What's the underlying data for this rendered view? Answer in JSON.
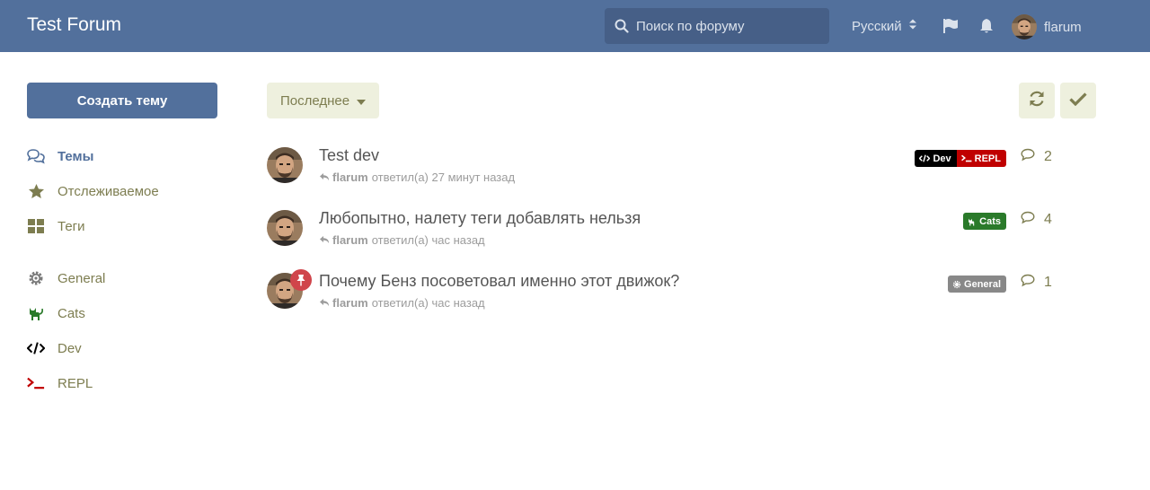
{
  "header": {
    "brand": "Test Forum",
    "search_placeholder": "Поиск по форуму",
    "language": "Русский",
    "user_name": "flarum"
  },
  "sidebar": {
    "new_discussion_label": "Создать тему",
    "items": [
      {
        "label": "Темы",
        "icon": "comments-icon",
        "active": true
      },
      {
        "label": "Отслеживаемое",
        "icon": "star-icon"
      },
      {
        "label": "Теги",
        "icon": "tags-grid-icon"
      },
      {
        "label": "General",
        "icon": "gear-icon"
      },
      {
        "label": "Cats",
        "icon": "cat-icon",
        "color": "#2a7a2a"
      },
      {
        "label": "Dev",
        "icon": "code-icon",
        "color": "#000000"
      },
      {
        "label": "REPL",
        "icon": "terminal-icon",
        "color": "#c00000"
      }
    ]
  },
  "toolbar": {
    "sort_label": "Последнее",
    "refresh_icon": "refresh-icon",
    "mark_read_icon": "check-icon"
  },
  "discussions": [
    {
      "title": "Test dev",
      "user": "flarum",
      "meta": "ответил(а) 27 минут назад",
      "tags": [
        {
          "label": "Dev",
          "icon": "code-icon",
          "color": "#000000"
        },
        {
          "label": "REPL",
          "icon": "terminal-icon",
          "color": "#c00000"
        }
      ],
      "replies": "2",
      "pinned": false
    },
    {
      "title": "Любопытно, налету теги добавлять нельзя",
      "user": "flarum",
      "meta": "ответил(а) час назад",
      "tags": [
        {
          "label": "Cats",
          "icon": "cat-icon",
          "color": "#2a7a2a"
        }
      ],
      "replies": "4",
      "pinned": false
    },
    {
      "title": "Почему Бенз посоветовал именно этот движок?",
      "user": "flarum",
      "meta": "ответил(а) час назад",
      "tags": [
        {
          "label": "General",
          "icon": "gear-icon",
          "color": "#888888"
        }
      ],
      "replies": "1",
      "pinned": true
    }
  ],
  "colors": {
    "header_bg": "#52709c",
    "accent": "#52709c",
    "muted_olive": "#7d7d50",
    "button_bg": "#eef0de",
    "pin": "#d0454b"
  }
}
